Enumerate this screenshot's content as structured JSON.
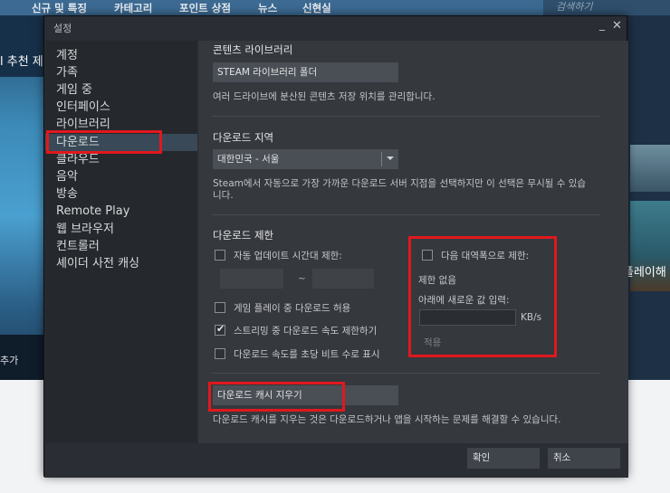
{
  "store_nav": {
    "items": [
      "신규 및 특징",
      "카테고리",
      "포인트 상점",
      "뉴스",
      "신현실"
    ],
    "search_placeholder": "검색하기",
    "left_banner": "l 추천 제",
    "right_banner": "플레이해",
    "left_bottom": "추가"
  },
  "dialog": {
    "title": "설정",
    "minimize_icon": "minimize-icon",
    "close_icon": "close-icon"
  },
  "sidebar": {
    "items": [
      {
        "label": "계정"
      },
      {
        "label": "가족"
      },
      {
        "label": "게임 중"
      },
      {
        "label": "인터페이스"
      },
      {
        "label": "라이브러리"
      },
      {
        "label": "다운로드",
        "selected": true
      },
      {
        "label": "클라우드"
      },
      {
        "label": "음악"
      },
      {
        "label": "방송"
      },
      {
        "label": "Remote Play"
      },
      {
        "label": "웹 브라우저"
      },
      {
        "label": "컨트롤러"
      },
      {
        "label": "셰이더 사전 캐싱"
      }
    ]
  },
  "content": {
    "library": {
      "title": "콘텐츠 라이브러리",
      "button": "STEAM 라이브러리 폴더",
      "desc": "여러 드라이브에 분산된 콘텐츠 저장 위치를 관리합니다."
    },
    "region": {
      "title": "다운로드 지역",
      "selected": "대한민국 - 서울",
      "desc": "Steam에서 자동으로 가장 가까운 다운로드 서버 지점을 선택하지만 이 선택은 무시될 수 있습니다."
    },
    "limits": {
      "title": "다운로드 제한",
      "auto_update_window": {
        "label": "자동 업데이트 시간대 제한:",
        "checked": false
      },
      "time_separator": "~",
      "allow_during_gameplay": {
        "label": "게임 플레이 중 다운로드 허용",
        "checked": false
      },
      "throttle_streaming": {
        "label": "스트리밍 중 다운로드 속도 제한하기",
        "checked": true
      },
      "show_bits": {
        "label": "다운로드 속도를 초당 비트 수로 표시",
        "checked": false
      },
      "bandwidth": {
        "label": "다음 대역폭으로 제한:",
        "checked": false,
        "current": "제한 없음",
        "new_value_label": "아래에 새로운 값 입력:",
        "unit": "KB/s",
        "apply": "적용"
      }
    },
    "cache": {
      "button": "다운로드 캐시 지우기",
      "desc": "다운로드 캐시를 지우는 것은 다운로드하거나 앱을 시작하는 문제를 해결할 수 있습니다."
    }
  },
  "footer": {
    "ok": "확인",
    "cancel": "취소"
  },
  "colors": {
    "highlight": "#e0181e",
    "selected_bg": "#3a4957",
    "dialog_bg": "#2a2d33"
  }
}
